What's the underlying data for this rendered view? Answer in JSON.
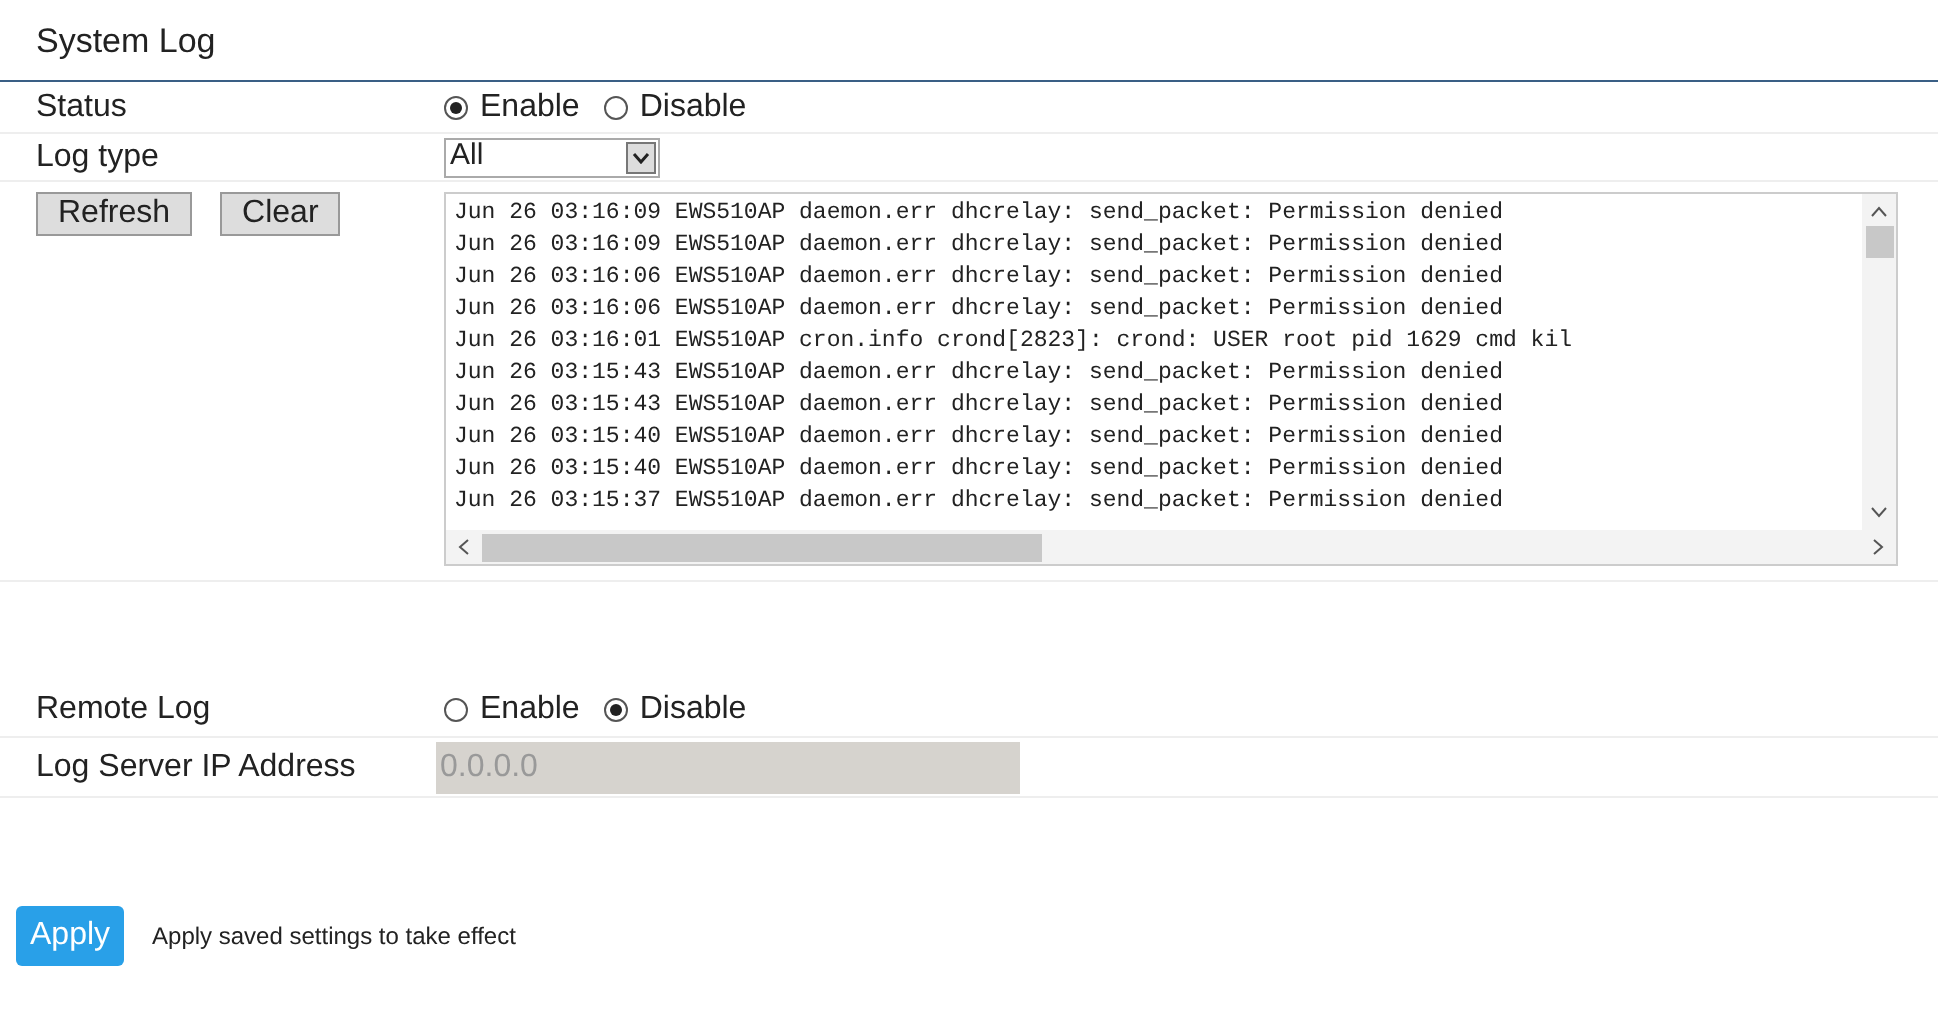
{
  "title": "System Log",
  "status": {
    "label": "Status",
    "options": [
      {
        "label": "Enable",
        "selected": true
      },
      {
        "label": "Disable",
        "selected": false
      }
    ]
  },
  "log_type": {
    "label": "Log type",
    "value": "All"
  },
  "buttons": [
    "Refresh",
    "Clear"
  ],
  "log_lines": [
    "Jun 26 03:16:09 EWS510AP daemon.err dhcrelay: send_packet: Permission denied",
    "Jun 26 03:16:09 EWS510AP daemon.err dhcrelay: send_packet: Permission denied",
    "Jun 26 03:16:06 EWS510AP daemon.err dhcrelay: send_packet: Permission denied",
    "Jun 26 03:16:06 EWS510AP daemon.err dhcrelay: send_packet: Permission denied",
    "Jun 26 03:16:01 EWS510AP cron.info crond[2823]: crond: USER root pid 1629 cmd kil",
    "Jun 26 03:15:43 EWS510AP daemon.err dhcrelay: send_packet: Permission denied",
    "Jun 26 03:15:43 EWS510AP daemon.err dhcrelay: send_packet: Permission denied",
    "Jun 26 03:15:40 EWS510AP daemon.err dhcrelay: send_packet: Permission denied",
    "Jun 26 03:15:40 EWS510AP daemon.err dhcrelay: send_packet: Permission denied",
    "Jun 26 03:15:37 EWS510AP daemon.err dhcrelay: send_packet: Permission denied"
  ],
  "remote_log": {
    "label": "Remote Log",
    "options": [
      {
        "label": "Enable",
        "selected": false
      },
      {
        "label": "Disable",
        "selected": true
      }
    ]
  },
  "log_server": {
    "label": "Log Server IP Address",
    "value": "0.0.0.0",
    "disabled": true
  },
  "apply": {
    "label": "Apply",
    "note": "Apply saved settings to take effect"
  }
}
